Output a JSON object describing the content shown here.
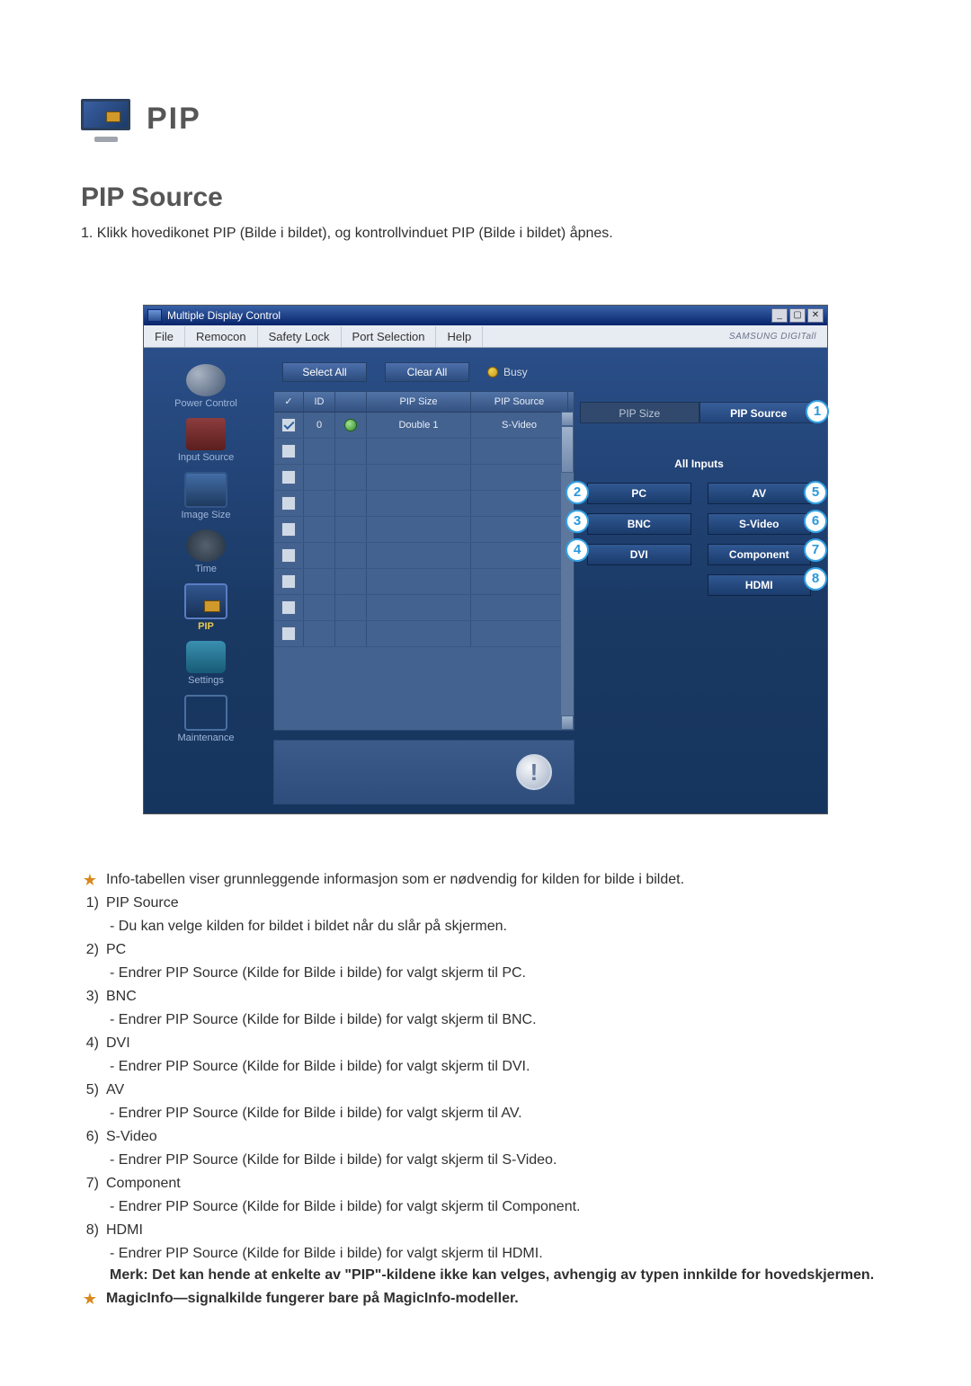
{
  "header": {
    "pip_label": "PIP",
    "section_title": "PIP Source",
    "intro_prefix": "1.  ",
    "intro_text": "Klikk hovedikonet PIP (Bilde i bildet), og kontrollvinduet PIP (Bilde i bildet) åpnes."
  },
  "window": {
    "title": "Multiple Display Control",
    "brand": "SAMSUNG DIGITall",
    "min_label": "_",
    "restore_label": "▢",
    "close_label": "✕"
  },
  "menu": {
    "file": "File",
    "remocon": "Remocon",
    "safety": "Safety Lock",
    "port": "Port Selection",
    "help": "Help"
  },
  "sidebar": {
    "power": "Power Control",
    "input": "Input Source",
    "image": "Image Size",
    "time": "Time",
    "pip": "PIP",
    "settings": "Settings",
    "maintenance": "Maintenance"
  },
  "toolbar": {
    "select_all": "Select All",
    "clear_all": "Clear All",
    "busy": "Busy"
  },
  "table": {
    "hdr_chk": "✓",
    "hdr_id": "ID",
    "hdr_stat": "",
    "hdr_size": "PIP Size",
    "hdr_src": "PIP Source",
    "row1_id": "0",
    "row1_size": "Double 1",
    "row1_src": "S-Video"
  },
  "right": {
    "tab_size": "PIP Size",
    "tab_source": "PIP Source",
    "all_inputs": "All Inputs",
    "pc": "PC",
    "av": "AV",
    "bnc": "BNC",
    "svideo": "S-Video",
    "dvi": "DVI",
    "component": "Component",
    "hdmi": "HDMI"
  },
  "badges": {
    "b1": "1",
    "b2": "2",
    "b3": "3",
    "b4": "4",
    "b5": "5",
    "b6": "6",
    "b7": "7",
    "b8": "8"
  },
  "alert_glyph": "!",
  "expl": {
    "star1": "Info-tabellen viser grunnleggende informasjon som er nødvendig for kilden for bilde i bildet.",
    "n1": "1)",
    "t1": "PIP Source",
    "d1": "- Du kan velge kilden for bildet i bildet når du slår på skjermen.",
    "n2": "2)",
    "t2": "PC",
    "d2": "- Endrer PIP Source (Kilde for Bilde i bilde) for valgt skjerm til PC.",
    "n3": "3)",
    "t3": "BNC",
    "d3": "- Endrer PIP Source (Kilde for Bilde i bilde) for valgt skjerm til BNC.",
    "n4": "4)",
    "t4": "DVI",
    "d4": "- Endrer PIP Source (Kilde for Bilde i bilde) for valgt skjerm til DVI.",
    "n5": "5)",
    "t5": "AV",
    "d5": "- Endrer PIP Source (Kilde for Bilde i bilde) for valgt skjerm til AV.",
    "n6": "6)",
    "t6": "S-Video",
    "d6": "- Endrer PIP Source (Kilde for Bilde i bilde) for valgt skjerm til S-Video.",
    "n7": "7)",
    "t7": "Component",
    "d7": "- Endrer PIP Source (Kilde for Bilde i bilde) for valgt skjerm til Component.",
    "n8": "8)",
    "t8": "HDMI",
    "d8": "- Endrer PIP Source (Kilde for Bilde i bilde) for valgt skjerm til HDMI.",
    "note": "Merk: Det kan hende at enkelte av \"PIP\"-kildene ikke kan velges, avhengig av typen innkilde for hovedskjermen.",
    "star2": "MagicInfo—signalkilde fungerer bare på MagicInfo-modeller."
  }
}
